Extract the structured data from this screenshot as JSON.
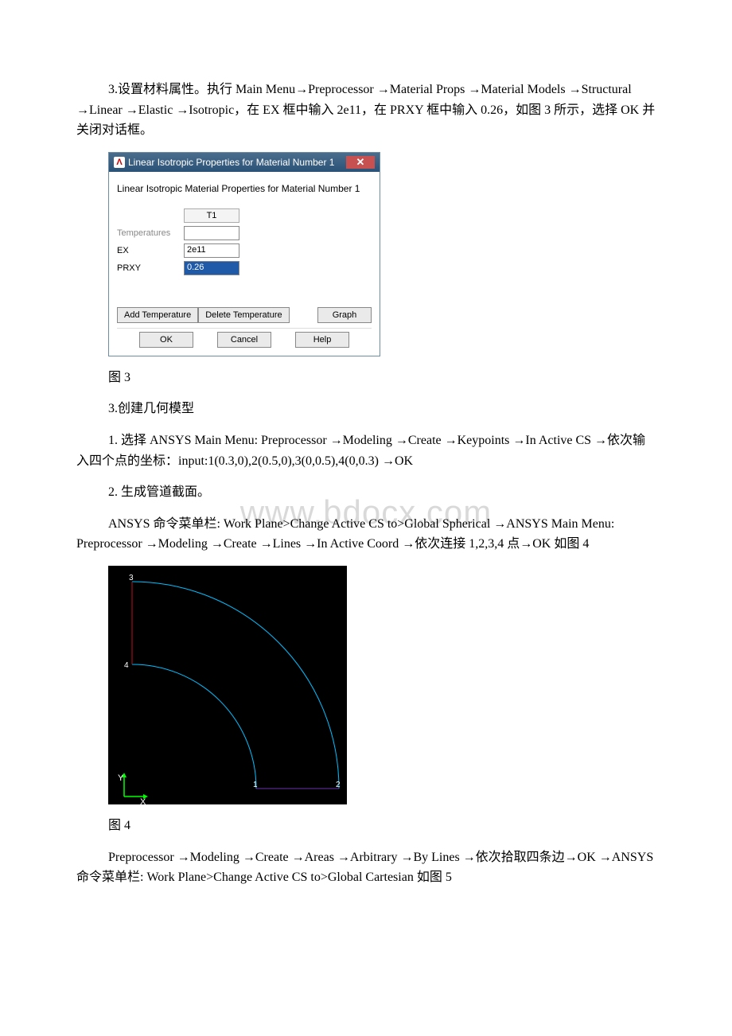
{
  "paragraphs": {
    "p1": "3.设置材料属性。执行 Main Menu→Preprocessor →Material Props →Material Models →Structural →Linear →Elastic →Isotropic，在 EX 框中输入 2e11，在 PRXY 框中输入 0.26，如图 3 所示，选择 OK 并关闭对话框。",
    "cap3": "图 3",
    "p2": "3.创建几何模型",
    "p3": "1. 选择 ANSYS Main Menu: Preprocessor →Modeling →Create →Keypoints →In Active CS →依次输入四个点的坐标：input:1(0.3,0),2(0.5,0),3(0,0.5),4(0,0.3) →OK",
    "p4": "2. 生成管道截面。",
    "p5": "ANSYS 命令菜单栏: Work Plane>Change Active CS to>Global Spherical →ANSYS Main Menu: Preprocessor →Modeling →Create →Lines →In Active Coord →依次连接 1,2,3,4 点→OK 如图 4",
    "cap4": "图 4",
    "p6": "Preprocessor →Modeling →Create →Areas →Arbitrary →By Lines →依次拾取四条边→OK →ANSYS 命令菜单栏: Work Plane>Change Active CS to>Global Cartesian 如图 5"
  },
  "dialog": {
    "title": "Linear Isotropic Properties for Material Number 1",
    "subtitle": "Linear Isotropic Material Properties for Material Number 1",
    "col_header": "T1",
    "rows": {
      "r1_label": "Temperatures",
      "r1_value": "",
      "r2_label": "EX",
      "r2_value": "2e11",
      "r3_label": "PRXY",
      "r3_value": "0.26"
    },
    "buttons": {
      "add_temp": "Add Temperature",
      "del_temp": "Delete Temperature",
      "graph": "Graph",
      "ok": "OK",
      "cancel": "Cancel",
      "help": "Help"
    },
    "close_icon_glyph": "✕"
  },
  "gfx": {
    "axis_y_label": "Y",
    "axis_x_label": "X",
    "kp_labels": {
      "k1": "1",
      "k2": "2",
      "k3": "3",
      "k4": "4"
    }
  },
  "watermark": "www.bdocx.com"
}
